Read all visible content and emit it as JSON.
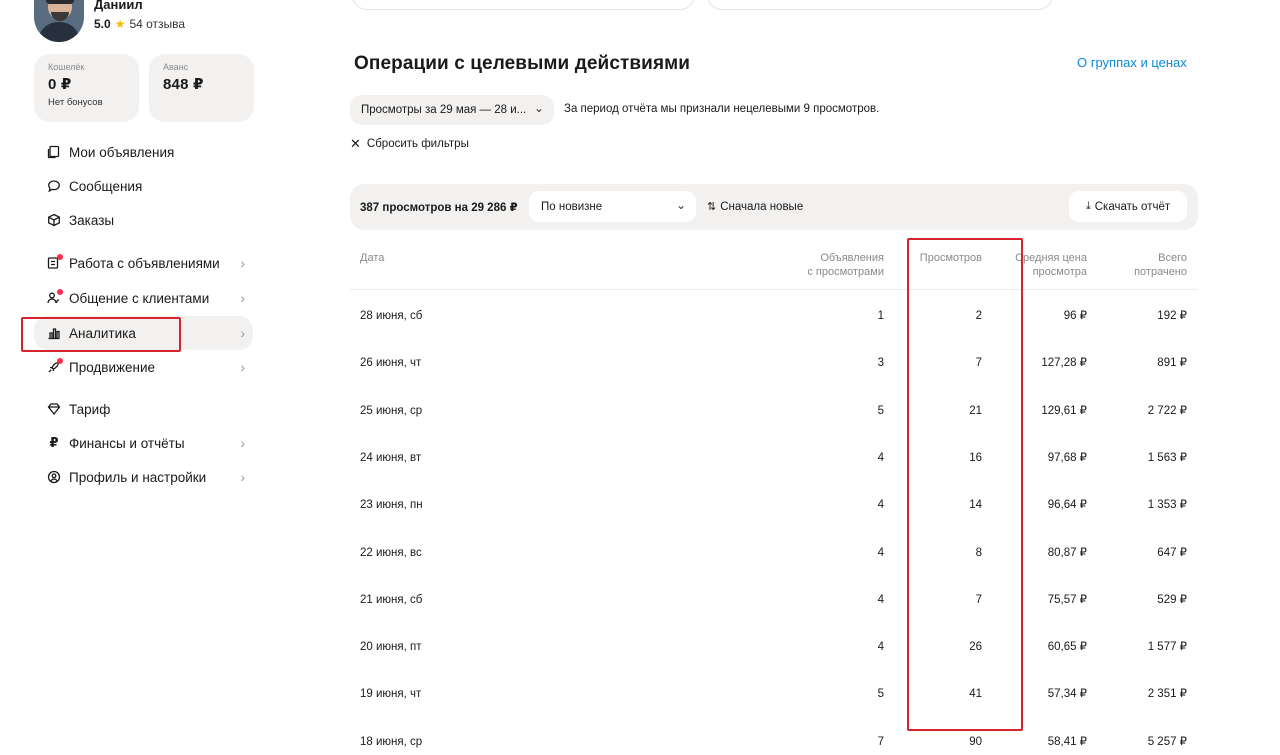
{
  "user": {
    "name": "Даниил",
    "rating": "5.0",
    "reviews": "54 отзыва"
  },
  "wallet": {
    "purse_label": "Кошелёк",
    "purse_value": "0 ₽",
    "purse_sub": "Нет бонусов",
    "advance_label": "Аванс",
    "advance_value": "848 ₽"
  },
  "nav": [
    {
      "label": "Мои объявления",
      "icon": "listings-icon",
      "chevron": false,
      "dot": false
    },
    {
      "label": "Сообщения",
      "icon": "chat-icon",
      "chevron": false,
      "dot": false
    },
    {
      "label": "Заказы",
      "icon": "box-icon",
      "chevron": false,
      "dot": false
    },
    {
      "label": "Работа с объявлениями",
      "icon": "work-icon",
      "chevron": true,
      "dot": true
    },
    {
      "label": "Общение с клиентами",
      "icon": "clients-icon",
      "chevron": true,
      "dot": true
    },
    {
      "label": "Аналитика",
      "icon": "analytics-icon",
      "chevron": true,
      "dot": false,
      "active": true
    },
    {
      "label": "Продвижение",
      "icon": "rocket-icon",
      "chevron": true,
      "dot": true
    },
    {
      "label": "Тариф",
      "icon": "diamond-icon",
      "chevron": false,
      "dot": false
    },
    {
      "label": "Финансы и отчёты",
      "icon": "ruble-icon",
      "chevron": true,
      "dot": false
    },
    {
      "label": "Профиль и настройки",
      "icon": "profile-icon",
      "chevron": true,
      "dot": false
    }
  ],
  "main": {
    "title": "Операции с целевыми действиями",
    "groups_link": "О группах и ценах",
    "period_select": "Просмотры за 29 мая — 28 и...",
    "period_note": "За период отчёта мы признали нецелевыми 9 просмотров.",
    "reset_filters": "Сбросить фильтры"
  },
  "toolbar": {
    "summary": "387 просмотров на 29 286 ₽",
    "sort_value": "По новизне",
    "order_label": "Сначала новые",
    "download_label": "Скачать отчёт"
  },
  "table": {
    "headers": {
      "date": "Дата",
      "listings_1": "Объявления",
      "listings_2": "с просмотрами",
      "views": "Просмотров",
      "avg_1": "Средняя цена",
      "avg_2": "просмотра",
      "total_1": "Всего",
      "total_2": "потрачено"
    },
    "rows": [
      {
        "date": "28 июня, сб",
        "listings": "1",
        "views": "2",
        "avg": "96 ₽",
        "total": "192 ₽"
      },
      {
        "date": "26 июня, чт",
        "listings": "3",
        "views": "7",
        "avg": "127,28 ₽",
        "total": "891 ₽"
      },
      {
        "date": "25 июня, ср",
        "listings": "5",
        "views": "21",
        "avg": "129,61 ₽",
        "total": "2 722 ₽"
      },
      {
        "date": "24 июня, вт",
        "listings": "4",
        "views": "16",
        "avg": "97,68 ₽",
        "total": "1 563 ₽"
      },
      {
        "date": "23 июня, пн",
        "listings": "4",
        "views": "14",
        "avg": "96,64 ₽",
        "total": "1 353 ₽"
      },
      {
        "date": "22 июня, вс",
        "listings": "4",
        "views": "8",
        "avg": "80,87 ₽",
        "total": "647 ₽"
      },
      {
        "date": "21 июня, сб",
        "listings": "4",
        "views": "7",
        "avg": "75,57 ₽",
        "total": "529 ₽"
      },
      {
        "date": "20 июня, пт",
        "listings": "4",
        "views": "26",
        "avg": "60,65 ₽",
        "total": "1 577 ₽"
      },
      {
        "date": "19 июня, чт",
        "listings": "5",
        "views": "41",
        "avg": "57,34 ₽",
        "total": "2 351 ₽"
      },
      {
        "date": "18 июня, ср",
        "listings": "7",
        "views": "90",
        "avg": "58,41 ₽",
        "total": "5 257 ₽"
      }
    ]
  },
  "colors": {
    "accent_link": "#0a8ad6",
    "highlight": "#d8222e",
    "notification_dot": "#ff2e4f",
    "star": "#ffb800",
    "surface": "#f2f1f0"
  }
}
